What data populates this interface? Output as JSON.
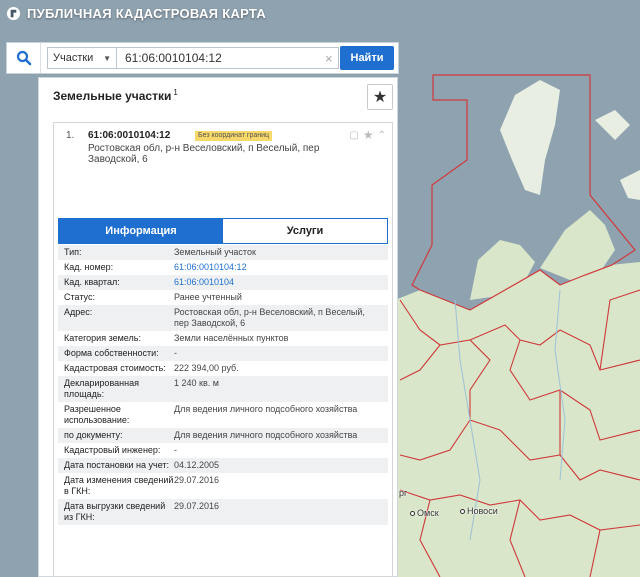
{
  "app": {
    "title": "ПУБЛИЧНАЯ КАДАСТРОВАЯ КАРТА",
    "logo_icon": "cadastre-logo-icon"
  },
  "search": {
    "type_label": "Участки",
    "query": "61:06:0010104:12",
    "clear_glyph": "×",
    "find_label": "Найти"
  },
  "panel": {
    "title": "Земельные участки",
    "count": "1",
    "star_glyph": "★"
  },
  "result": {
    "index": "1.",
    "cad_number": "61:06:0010104:12",
    "badge": "Без координат границ",
    "address": "Ростовская обл, р-н Веселовский, п Веселый, пер Заводской, 6"
  },
  "tabs": [
    {
      "label": "Информация",
      "active": true
    },
    {
      "label": "Услуги",
      "active": false
    }
  ],
  "properties": [
    {
      "label": "Тип:",
      "value": "Земельный участок",
      "link": false
    },
    {
      "label": "Кад. номер:",
      "value": "61:06:0010104:12",
      "link": true
    },
    {
      "label": "Кад. квартал:",
      "value": "61:06:0010104",
      "link": true
    },
    {
      "label": "Статус:",
      "value": "Ранее учтенный",
      "link": false
    },
    {
      "label": "Адрес:",
      "value": "Ростовская обл, р-н Веселовский, п Веселый, пер Заводской, 6",
      "link": false
    },
    {
      "label": "Категория земель:",
      "value": "Земли населённых пунктов",
      "link": false
    },
    {
      "label": "Форма собственности:",
      "value": "-",
      "link": false
    },
    {
      "label": "Кадастровая стоимость:",
      "value": "222 394,00 руб.",
      "link": false
    },
    {
      "label": "Декларированная площадь:",
      "value": "1 240 кв. м",
      "link": false
    },
    {
      "label": "Разрешенное использование:",
      "value": "Для ведения личного подсобного хозяйства",
      "link": false
    },
    {
      "label": "по документу:",
      "value": "Для ведения личного подсобного хозяйства",
      "link": false
    },
    {
      "label": "Кадастровый инженер:",
      "value": "-",
      "link": false
    },
    {
      "label": "Дата постановки на учет:",
      "value": "04.12.2005",
      "link": false
    },
    {
      "label": "Дата изменения сведений в ГКН:",
      "value": "29.07.2016",
      "link": false
    },
    {
      "label": "Дата выгрузки сведений из ГКН:",
      "value": "29.07.2016",
      "link": false
    }
  ],
  "map": {
    "cities": [
      {
        "name": "Омск"
      },
      {
        "name": "Новоси"
      },
      {
        "name": "рг"
      }
    ],
    "colors": {
      "land": "#d9e6c9",
      "water": "#8fa2b0",
      "border": "#d0383a"
    }
  }
}
